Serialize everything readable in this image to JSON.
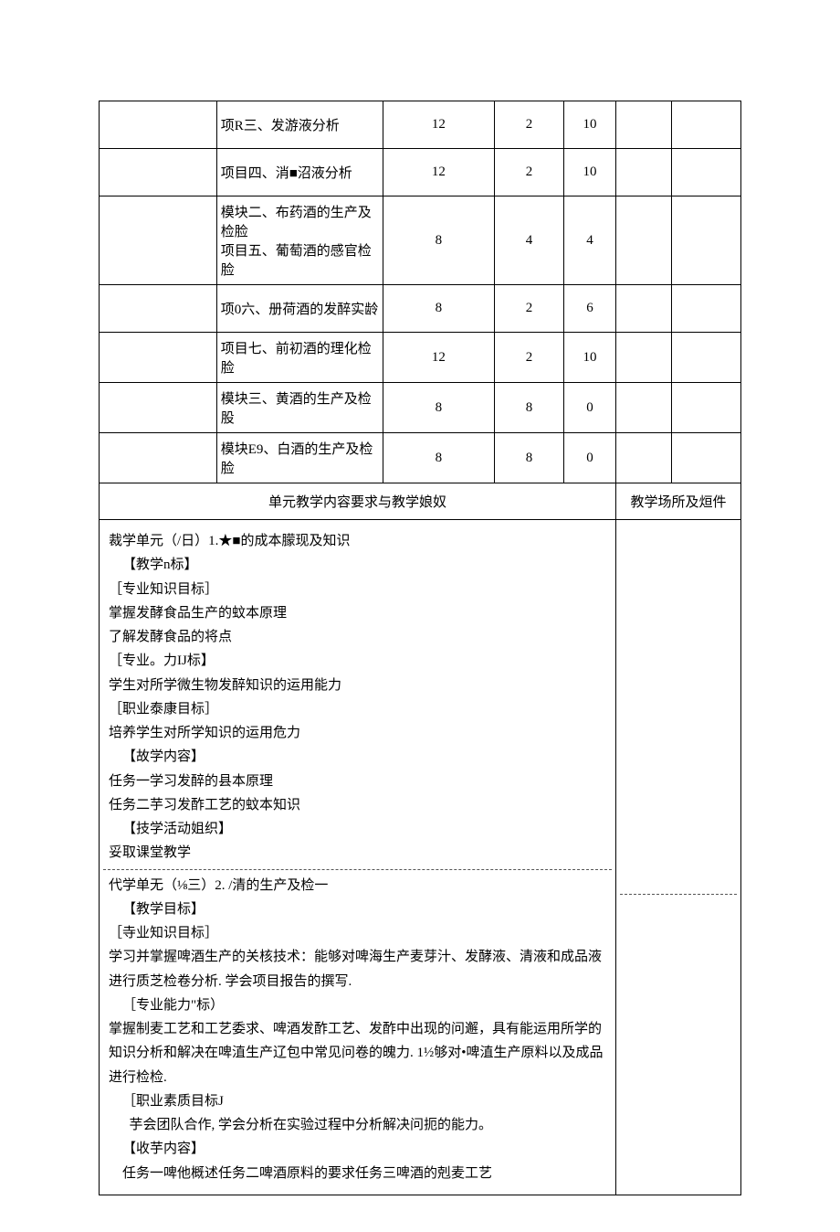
{
  "rows": [
    {
      "desc": "项R三、发游液分析",
      "c1": "12",
      "c2": "2",
      "c3": "10",
      "c4": "",
      "c5": ""
    },
    {
      "desc": "项目四、消■沼液分析",
      "c1": "12",
      "c2": "2",
      "c3": "10",
      "c4": "",
      "c5": ""
    },
    {
      "desc": "模块二、布药酒的生产及检脸\n项目五、葡萄酒的感官检脸",
      "c1": "8",
      "c2": "4",
      "c3": "4",
      "c4": "",
      "c5": ""
    },
    {
      "desc": "项0六、册荷酒的发醉实龄",
      "c1": "8",
      "c2": "2",
      "c3": "6",
      "c4": "",
      "c5": ""
    },
    {
      "desc": "项目七、前初酒的理化检脸",
      "c1": "12",
      "c2": "2",
      "c3": "10",
      "c4": "",
      "c5": ""
    },
    {
      "desc": "模块三、黄酒的生产及检股",
      "c1": "8",
      "c2": "8",
      "c3": "0",
      "c4": "",
      "c5": ""
    },
    {
      "desc": "模块E9、白酒的生产及检脸",
      "c1": "8",
      "c2": "8",
      "c3": "0",
      "c4": "",
      "c5": ""
    }
  ],
  "header_row": {
    "left": "单元教学内容要求与教学娘奴",
    "right": "教学场所及烜件"
  },
  "unit1": {
    "title": "裁学单元（/日）1.★■的成本朦现及知识",
    "l2": "【教学n标】",
    "l3": "［专业知识目标］",
    "l4": "掌握发酵食品生产的蚊本原理",
    "l5": "了解发酵食品的将点",
    "l6": "［专业。力IJ标】",
    "l7": "学生对所学微生物发醉知识的运用能力",
    "l8": "［职业泰康目标］",
    "l9": "培养学生对所学知识的运用危力",
    "l10": "【故学内容】",
    "l11": "任务一学习发醉的县本原理",
    "l12": "任务二芋习发酢工艺的蚊本知识",
    "l13": "【技学活动姐织】",
    "l14": "妥取课堂教学"
  },
  "unit2": {
    "l1": "代学单无（⅛三）2. /清的生产及检一",
    "l2": "【教学目标】",
    "l3": "［寺业知识目标］",
    "l4": "学习并掌握啤酒生产的关核技术：能够对啤海生产麦芽汁、发酵液、清液和成品液进行质芝检卷分析. 学会项目报告的撰写.",
    "l5": "［专业能力\"标）",
    "l6": "掌握制麦工艺和工艺委求、啤酒发酢工艺、发酢中出现的问邂，具有能运用所学的知识分析和解决在啤淔生产辽包中常见问卷的魄力. 1½够对•啤淔生产原料以及成品进行检检.",
    "l7": "［职业素质目标J",
    "l8": "芋会团队合作, 学会分析在实验过程中分析解决问扼的能力。",
    "l9": "【收芋内容】",
    "l10": "任务一啤他概述任务二啤酒原料的要求任务三啤酒的剋麦工艺"
  }
}
